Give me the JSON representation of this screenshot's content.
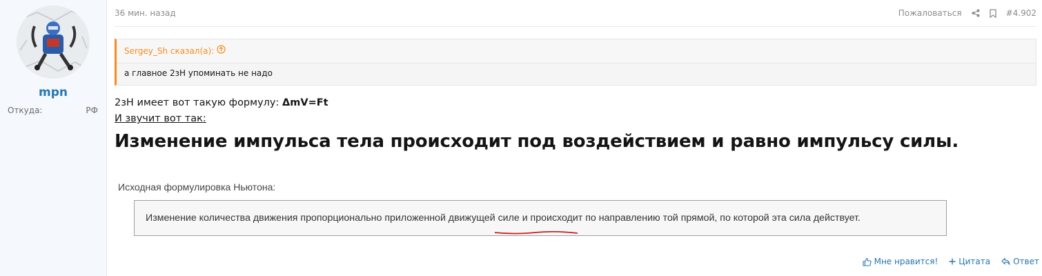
{
  "user": {
    "name": "mpn",
    "from_label": "Откуда:",
    "from_value": "РФ"
  },
  "post": {
    "time": "36 мин. назад",
    "actions": {
      "report": "Пожаловаться",
      "number": "#4.902"
    },
    "quote": {
      "author": "Sergey_Sh сказал(а):",
      "text": "а главное 2зН упоминать не надо"
    },
    "line1_prefix": "2зН имеет вот такую формулу: ",
    "line1_formula": "ΔmV=Ft",
    "line2": "И звучит вот так:",
    "big_text": "Изменение импульса тела происходит под воздействием и равно импульсу силы.",
    "embed": {
      "title": "Исходная формулировка Ньютона:",
      "text": "Изменение количества движения пропорционально приложенной движущей силе и происходит по направлению той прямой, по которой эта сила действует."
    },
    "footer": {
      "like": "Мне нравится!",
      "quote": "Цитата",
      "reply": "Ответ"
    }
  },
  "colors": {
    "link": "#2577b1",
    "quote_accent": "#f78c1f",
    "underline_red": "#cc1f1f"
  }
}
